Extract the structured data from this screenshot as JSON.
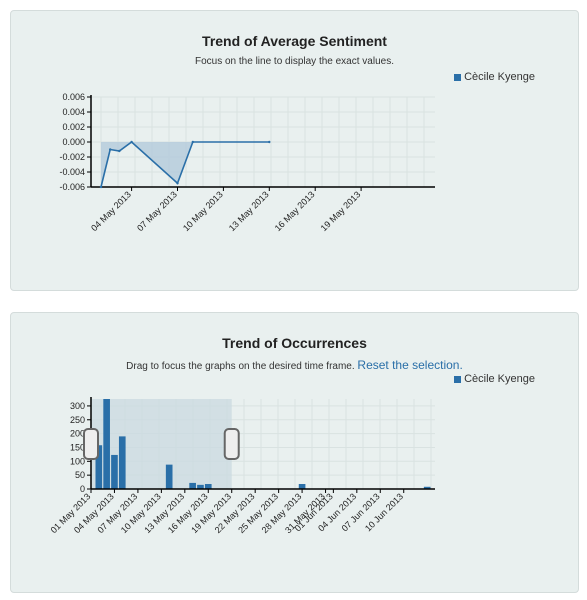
{
  "sentiment": {
    "title": "Trend of Average Sentiment",
    "subtitle": "Focus on the line to display the exact values.",
    "legend_label": "Cècile Kyenge",
    "colors": {
      "series": "#2a6fa8",
      "area": "#b3cadb"
    }
  },
  "occurrences": {
    "title": "Trend of Occurrences",
    "subtitle": "Drag to focus the graphs on the desired time frame.",
    "reset_label": "Reset the selection.",
    "legend_label": "Cècile Kyenge",
    "colors": {
      "series": "#2a6fa8",
      "brush": "#c9d9e0"
    }
  },
  "chart_data": [
    {
      "type": "area",
      "title": "Trend of Average Sentiment",
      "series": [
        {
          "name": "Cècile Kyenge",
          "x": [
            1.0,
            1.6,
            2.2,
            3.0,
            6.0,
            7.0,
            12.0
          ],
          "y": [
            -0.006,
            -0.001,
            -0.0012,
            0.0,
            -0.0055,
            0.0,
            0.0
          ]
        }
      ],
      "xlim": [
        1.0,
        12.0
      ],
      "ylim": [
        -0.006,
        0.006
      ],
      "yticks": [
        "0.006",
        "0.004",
        "0.002",
        "0.000",
        "-0.002",
        "-0.004",
        "-0.006"
      ],
      "xticks": [
        {
          "x": 3.0,
          "label": "04 May 2013"
        },
        {
          "x": 6.0,
          "label": "07 May 2013"
        },
        {
          "x": 9.0,
          "label": "10 May 2013"
        },
        {
          "x": 12.0,
          "label": "13 May 2013"
        },
        {
          "x": 15.0,
          "label": "16 May 2013"
        },
        {
          "x": 18.0,
          "label": "19 May 2013"
        }
      ],
      "grid": true
    },
    {
      "type": "bar",
      "title": "Trend of Occurrences",
      "series": [
        {
          "name": "Cècile Kyenge",
          "x": [
            2,
            3,
            4,
            5,
            11,
            14,
            15,
            16,
            28,
            44
          ],
          "values": [
            158,
            325,
            123,
            190,
            88,
            22,
            15,
            18,
            18,
            8
          ]
        }
      ],
      "xlim": [
        1,
        45
      ],
      "ylim": [
        0,
        325
      ],
      "yticks": [
        "300",
        "250",
        "200",
        "150",
        "100",
        "50",
        "0"
      ],
      "xticks": [
        {
          "x": 1,
          "label": "01 May 2013"
        },
        {
          "x": 4,
          "label": "04 May 2013"
        },
        {
          "x": 7,
          "label": "07 May 2013"
        },
        {
          "x": 10,
          "label": "10 May 2013"
        },
        {
          "x": 13,
          "label": "13 May 2013"
        },
        {
          "x": 16,
          "label": "16 May 2013"
        },
        {
          "x": 19,
          "label": "19 May 2013"
        },
        {
          "x": 22,
          "label": "22 May 2013"
        },
        {
          "x": 25,
          "label": "25 May 2013"
        },
        {
          "x": 28,
          "label": "28 May 2013"
        },
        {
          "x": 31,
          "label": "31 May 2013"
        },
        {
          "x": 32,
          "label": "01 Jun 2013"
        },
        {
          "x": 35,
          "label": "04 Jun 2013"
        },
        {
          "x": 38,
          "label": "07 Jun 2013"
        },
        {
          "x": 41,
          "label": "10 Jun 2013"
        }
      ],
      "selection": [
        1,
        19
      ],
      "grid": true
    }
  ]
}
